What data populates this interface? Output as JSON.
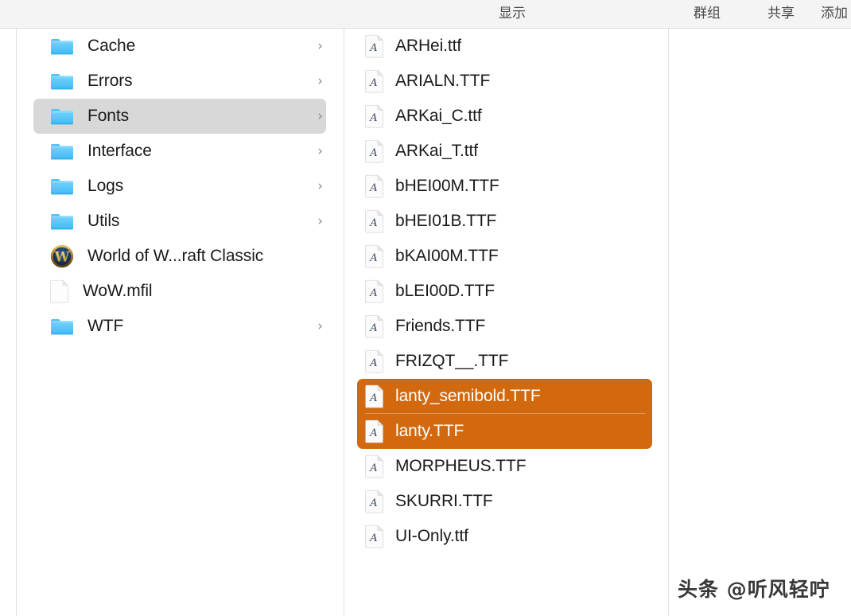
{
  "window": {
    "app": "Finder",
    "view_mode": "column-view"
  },
  "toolbar": {
    "items": [
      {
        "label": "显示",
        "name": "toolbar-display"
      },
      {
        "label": "群组",
        "name": "toolbar-group"
      },
      {
        "label": "共享",
        "name": "toolbar-share"
      },
      {
        "label": "添加",
        "name": "toolbar-add"
      }
    ],
    "display_label": "显示",
    "group_label": "群组",
    "share_label": "共享",
    "add_label": "添加"
  },
  "colors": {
    "selection_orange": "#d2690e",
    "selection_gray": "#d8d8d8",
    "toolbar_bg": "#f4f4f5",
    "divider": "#e0e0e1",
    "folder_blue": "#5ac8fa",
    "text_primary": "#1b1b1c"
  },
  "sidebar": {
    "name": "finder-column-parent",
    "items": [
      {
        "label": "Cache",
        "icon": "folder-icon",
        "chevron": "›",
        "selected": false
      },
      {
        "label": "Errors",
        "icon": "folder-icon",
        "chevron": "›",
        "selected": false
      },
      {
        "label": "Fonts",
        "icon": "folder-icon",
        "chevron": "›",
        "selected": true
      },
      {
        "label": "Interface",
        "icon": "folder-icon",
        "chevron": "›",
        "selected": false
      },
      {
        "label": "Logs",
        "icon": "folder-icon",
        "chevron": "›",
        "selected": false
      },
      {
        "label": "Utils",
        "icon": "folder-icon",
        "chevron": "›",
        "selected": false
      },
      {
        "label": "World of W...raft Classic",
        "icon": "wow-app-icon",
        "chevron": "",
        "selected": false
      },
      {
        "label": "WoW.mfil",
        "icon": "document-icon",
        "chevron": "",
        "selected": false
      },
      {
        "label": "WTF",
        "icon": "folder-icon",
        "chevron": "›",
        "selected": false
      }
    ]
  },
  "files": {
    "name": "finder-column-fonts",
    "items": [
      {
        "label": "ARHei.ttf",
        "icon": "font-file-icon",
        "selected": false
      },
      {
        "label": "ARIALN.TTF",
        "icon": "font-file-icon",
        "selected": false
      },
      {
        "label": "ARKai_C.ttf",
        "icon": "font-file-icon",
        "selected": false
      },
      {
        "label": "ARKai_T.ttf",
        "icon": "font-file-icon",
        "selected": false
      },
      {
        "label": "bHEI00M.TTF",
        "icon": "font-file-icon",
        "selected": false
      },
      {
        "label": "bHEI01B.TTF",
        "icon": "font-file-icon",
        "selected": false
      },
      {
        "label": "bKAI00M.TTF",
        "icon": "font-file-icon",
        "selected": false
      },
      {
        "label": "bLEI00D.TTF",
        "icon": "font-file-icon",
        "selected": false
      },
      {
        "label": "Friends.TTF",
        "icon": "font-file-icon",
        "selected": false
      },
      {
        "label": "FRIZQT__.TTF",
        "icon": "font-file-icon",
        "selected": false
      },
      {
        "label": "lanty_semibold.TTF",
        "icon": "font-file-icon",
        "selected": true
      },
      {
        "label": "lanty.TTF",
        "icon": "font-file-icon",
        "selected": true
      },
      {
        "label": "MORPHEUS.TTF",
        "icon": "font-file-icon",
        "selected": false
      },
      {
        "label": "SKURRI.TTF",
        "icon": "font-file-icon",
        "selected": false
      },
      {
        "label": "UI-Only.ttf",
        "icon": "font-file-icon",
        "selected": false
      }
    ]
  },
  "preview": {
    "name": "finder-preview-column",
    "empty": true
  },
  "watermark": {
    "text": "头条 @听风轻咛"
  }
}
